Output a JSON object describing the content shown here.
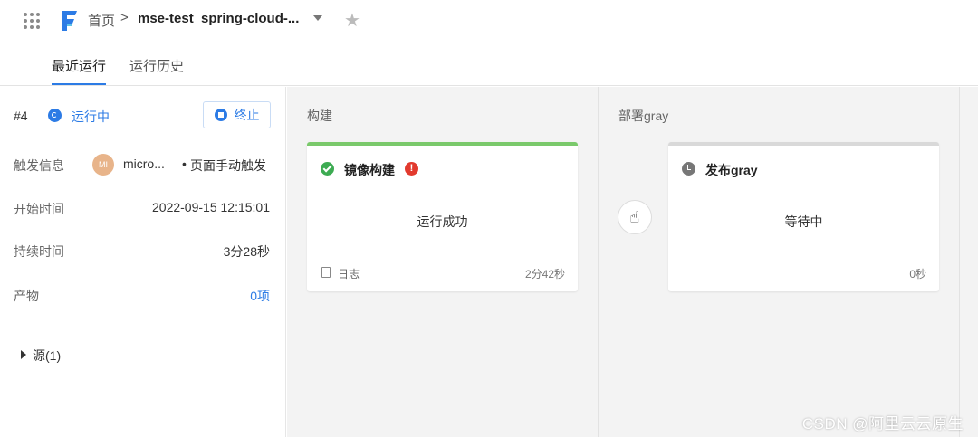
{
  "header": {
    "breadcrumb_home": "首页",
    "breadcrumb_sep": ">",
    "project_name": "mse-test_spring-cloud-...",
    "icons": [
      "apps-grid-icon",
      "logo-icon",
      "chevron-down-icon",
      "star-icon"
    ]
  },
  "tabs": [
    {
      "label": "最近运行",
      "active": true
    },
    {
      "label": "运行历史",
      "active": false
    }
  ],
  "run": {
    "number": "#4",
    "status": "运行中",
    "stop_label": "终止",
    "trigger_label": "触发信息",
    "trigger_avatar": "MI",
    "trigger_user": "micro...",
    "trigger_dot": "•",
    "trigger_mode": "页面手动触发",
    "start_label": "开始时间",
    "start_value": "2022-09-15 12:15:01",
    "duration_label": "持续时间",
    "duration_value": "3分28秒",
    "artifact_label": "产物",
    "artifact_value": "0项",
    "source_label": "源(1)"
  },
  "stages": [
    {
      "title": "构建",
      "card": {
        "name": "镜像构建",
        "status": "运行成功",
        "log_label": "日志",
        "duration": "2分42秒",
        "bar_color": "#7ac96b"
      }
    },
    {
      "title": "部署gray",
      "card": {
        "name": "发布gray",
        "status": "等待中",
        "duration": "0秒",
        "bar_color": "#d9d9d9"
      }
    }
  ],
  "colors": {
    "accent": "#2c7be5",
    "success": "#3dab52",
    "error": "#e23a2e"
  },
  "watermark": "CSDN @阿里云云原生"
}
